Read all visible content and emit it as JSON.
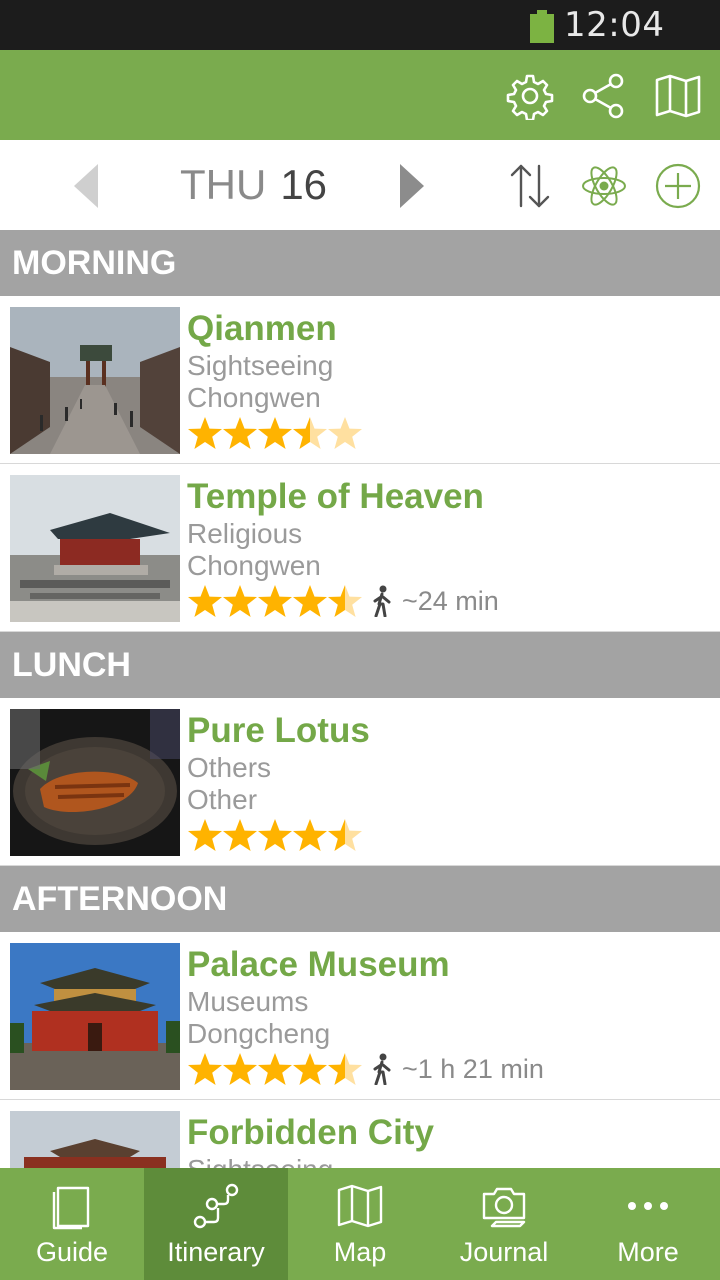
{
  "status_bar": {
    "time": "12:04 PM"
  },
  "action_bar": {
    "icons": [
      "gear-icon",
      "share-icon",
      "map-icon"
    ]
  },
  "date_bar": {
    "day_of_week": "THU",
    "day": "16",
    "icons": [
      "chevron-left-icon",
      "chevron-right-icon",
      "sort-icon",
      "atom-icon",
      "add-circle-icon"
    ]
  },
  "sections": [
    {
      "label": "MORNING"
    },
    {
      "label": "LUNCH"
    },
    {
      "label": "AFTERNOON"
    }
  ],
  "items": [
    {
      "title": "Qianmen",
      "category": "Sightseeing",
      "area": "Chongwen",
      "rating": 3.5,
      "walk": ""
    },
    {
      "title": "Temple of Heaven",
      "category": "Religious",
      "area": "Chongwen",
      "rating": 4.5,
      "walk": "~24 min"
    },
    {
      "title": "Pure Lotus",
      "category": "Others",
      "area": "Other",
      "rating": 4.5,
      "walk": ""
    },
    {
      "title": "Palace Museum",
      "category": "Museums",
      "area": "Dongcheng",
      "rating": 4.5,
      "walk": "~1 h 21 min"
    },
    {
      "title": "Forbidden City",
      "category": "Sightseeing",
      "area": "",
      "rating": 0,
      "walk": ""
    }
  ],
  "tabs": [
    {
      "label": "Guide",
      "icon": "book-icon"
    },
    {
      "label": "Itinerary",
      "icon": "route-icon",
      "active": true
    },
    {
      "label": "Map",
      "icon": "map-icon"
    },
    {
      "label": "Journal",
      "icon": "camera-icon"
    },
    {
      "label": "More",
      "icon": "more-dots-icon"
    }
  ],
  "colors": {
    "brand_green": "#7aab4e",
    "active_tab": "#5e8c3a",
    "title_green": "#74a848",
    "star": "#ffb300",
    "star_empty": "#ffe0a0",
    "section_gray": "#a3a3a3"
  }
}
